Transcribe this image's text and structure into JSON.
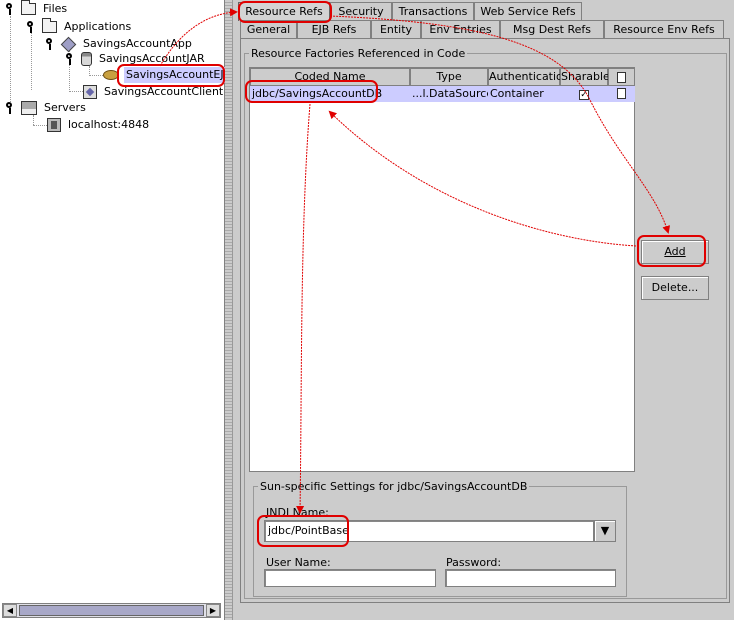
{
  "tree": {
    "files": "Files",
    "applications": "Applications",
    "app": "SavingsAccountApp",
    "jar": "SavingsAccountJAR",
    "ejb": "SavingsAccountEJB",
    "client": "SavingsAccountClient",
    "servers": "Servers",
    "host": "localhost:4848"
  },
  "tabs_row1": [
    "Resource Refs",
    "Security",
    "Transactions",
    "Web Service Refs"
  ],
  "tabs_row2": [
    "General",
    "EJB Refs",
    "Entity",
    "Env Entries",
    "Msg Dest Refs",
    "Resource Env Refs"
  ],
  "active_tab": "Resource Refs",
  "factories_group": {
    "title": "Resource Factories Referenced in Code",
    "columns": [
      "Coded Name",
      "Type",
      "Authentication",
      "Sharable"
    ],
    "rows": [
      {
        "coded_name": "jdbc/SavingsAccountDB",
        "type": "...l.DataSource",
        "authentication": "Container",
        "sharable": true
      }
    ]
  },
  "buttons": {
    "add": "Add",
    "delete": "Delete..."
  },
  "sun_settings": {
    "title": "Sun-specific Settings for jdbc/SavingsAccountDB",
    "jndi_label": "JNDI Name:",
    "jndi_value": "jdbc/PointBase",
    "user_label": "User Name:",
    "user_value": "",
    "password_label": "Password:",
    "password_value": ""
  },
  "colors": {
    "selection": "#ccccff",
    "highlight": "#e00000",
    "background": "#cccccc"
  }
}
